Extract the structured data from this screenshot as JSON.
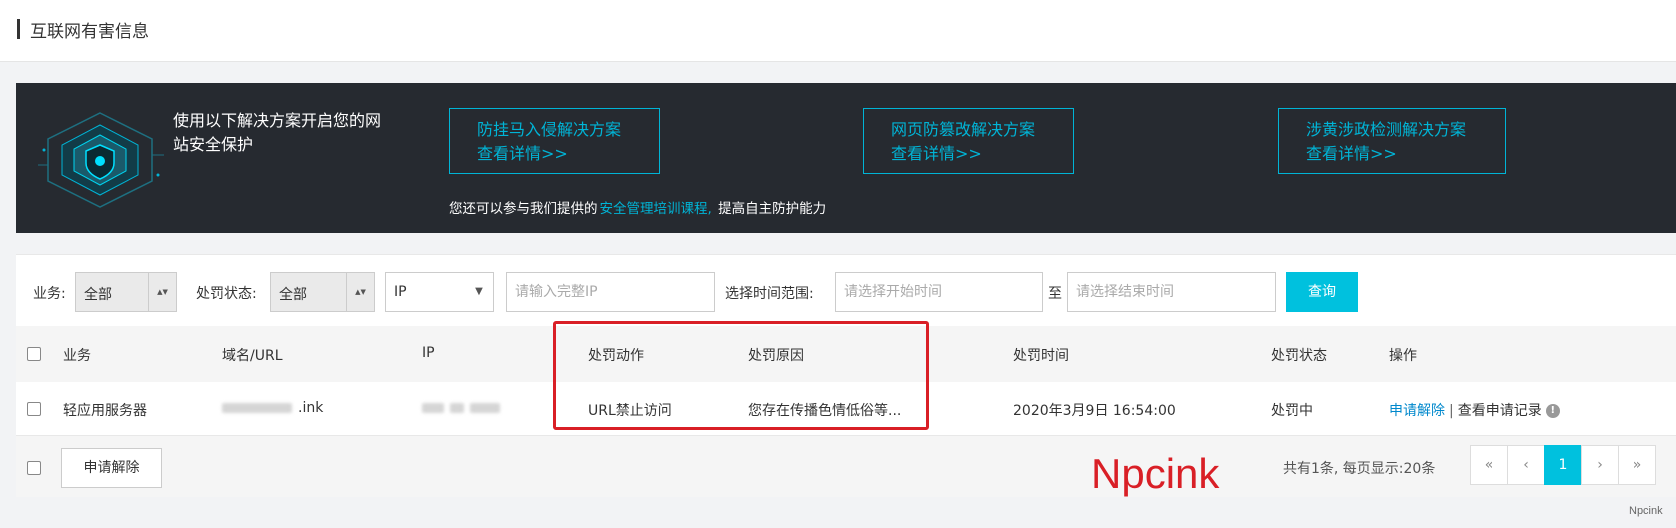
{
  "header": {
    "title": "互联网有害信息"
  },
  "banner": {
    "intro": "使用以下解决方案开启您的网站安全保护",
    "solutions": [
      {
        "title": "防挂马入侵解决方案",
        "link": "查看详情>>"
      },
      {
        "title": "网页防篡改解决方案",
        "link": "查看详情>>"
      },
      {
        "title": "涉黄涉政检测解决方案",
        "link": "查看详情>>"
      }
    ],
    "training_prefix": "您还可以参与我们提供的",
    "training_link": "安全管理培训课程,",
    "training_suffix": "提高自主防护能力"
  },
  "filters": {
    "business_label": "业务:",
    "business_value": "全部",
    "status_label": "处罚状态:",
    "status_value": "全部",
    "ip_type_value": "IP",
    "ip_placeholder": "请输入完整IP",
    "time_range_label": "选择时间范围:",
    "start_placeholder": "请选择开始时间",
    "to_label": "至",
    "end_placeholder": "请选择结束时间",
    "query_button": "查询"
  },
  "table": {
    "columns": [
      "业务",
      "域名/URL",
      "IP",
      "处罚动作",
      "处罚原因",
      "处罚时间",
      "处罚状态",
      "操作"
    ],
    "rows": [
      {
        "business": "轻应用服务器",
        "url_suffix": ".ink",
        "action": "URL禁止访问",
        "reason": "您存在传播色情低俗等...",
        "time": "2020年3月9日 16:54:00",
        "status": "处罚中",
        "op_unban": "申请解除",
        "op_separator": "|",
        "op_history": "查看申请记录"
      }
    ]
  },
  "footer": {
    "bulk_unban": "申请解除",
    "total_text": "共有1条, 每页显示:20条",
    "pager": {
      "first": "«",
      "prev": "‹",
      "current": "1",
      "next": "›",
      "last": "»"
    }
  },
  "watermark": "Npcink",
  "corner_mark": "Npcink",
  "colors": {
    "accent": "#00c1de",
    "highlight_box": "#d91f26",
    "banner_bg": "#262a30",
    "link": "#0088cc"
  }
}
